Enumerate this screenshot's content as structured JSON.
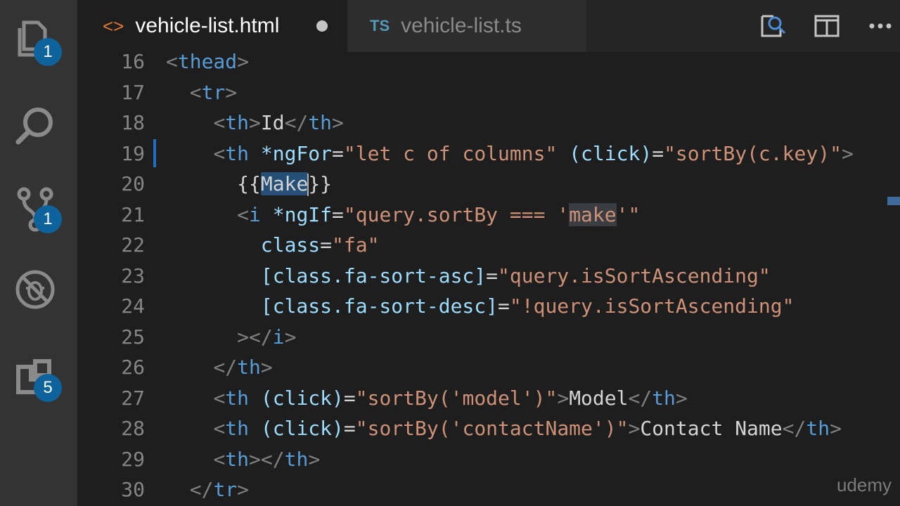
{
  "activity_bar": {
    "explorer_badge": "1",
    "source_control_badge": "1",
    "extensions_badge": "5"
  },
  "tabs": [
    {
      "label": "vehicle-list.html",
      "icon": "<>",
      "active": true,
      "dirty": true
    },
    {
      "label": "vehicle-list.ts",
      "icon": "TS",
      "active": false
    }
  ],
  "editor": {
    "line_numbers": [
      "16",
      "17",
      "18",
      "19",
      "20",
      "21",
      "22",
      "23",
      "24",
      "25",
      "26",
      "27",
      "28",
      "29",
      "30"
    ]
  },
  "watermark": "udemy",
  "colors": {
    "activity_bar": "#333333",
    "tab_bar": "#252526",
    "editor_bg": "#1e1e1e",
    "badge": "#0e639c",
    "tag": "#569cd6",
    "attribute": "#9cdcfe",
    "string": "#ce9178"
  }
}
